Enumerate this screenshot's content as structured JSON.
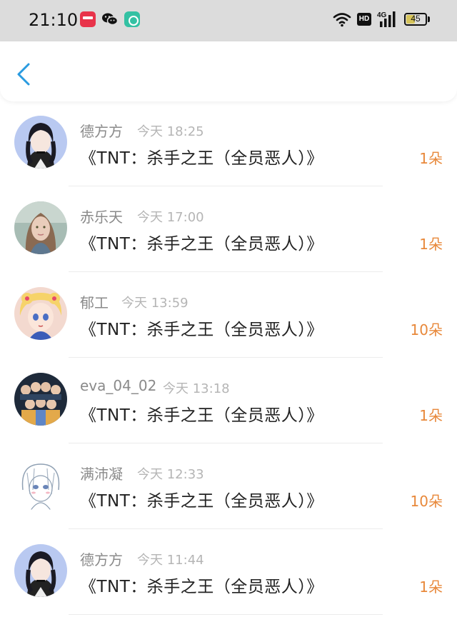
{
  "status_bar": {
    "time": "21:10",
    "battery_level": "45",
    "network": "4G",
    "hd_label": "HD",
    "icons": [
      "app-badge-icon",
      "wechat-icon",
      "chat-bubble-icon",
      "wifi-icon",
      "signal-icon",
      "battery-icon"
    ]
  },
  "nav": {
    "back_icon": "chevron-left-icon"
  },
  "accent_colors": {
    "amount": "#e8883a",
    "back_arrow": "#2a9be0"
  },
  "items": [
    {
      "name": "德方方",
      "time": "今天 18:25",
      "title": "《TNT：杀手之王（全员恶人）》",
      "amount": "1朵"
    },
    {
      "name": "赤乐天",
      "time": "今天 17:00",
      "title": "《TNT：杀手之王（全员恶人）》",
      "amount": "1朵"
    },
    {
      "name": "郁工",
      "time": "今天 13:59",
      "title": "《TNT：杀手之王（全员恶人）》",
      "amount": "10朵"
    },
    {
      "name": "eva_04_02",
      "time": "今天 13:18",
      "title": "《TNT：杀手之王（全员恶人）》",
      "amount": "1朵"
    },
    {
      "name": "满沛凝",
      "time": "今天 12:33",
      "title": "《TNT：杀手之王（全员恶人）》",
      "amount": "10朵"
    },
    {
      "name": "德方方",
      "time": "今天 11:44",
      "title": "《TNT：杀手之王（全员恶人）》",
      "amount": "1朵"
    }
  ]
}
